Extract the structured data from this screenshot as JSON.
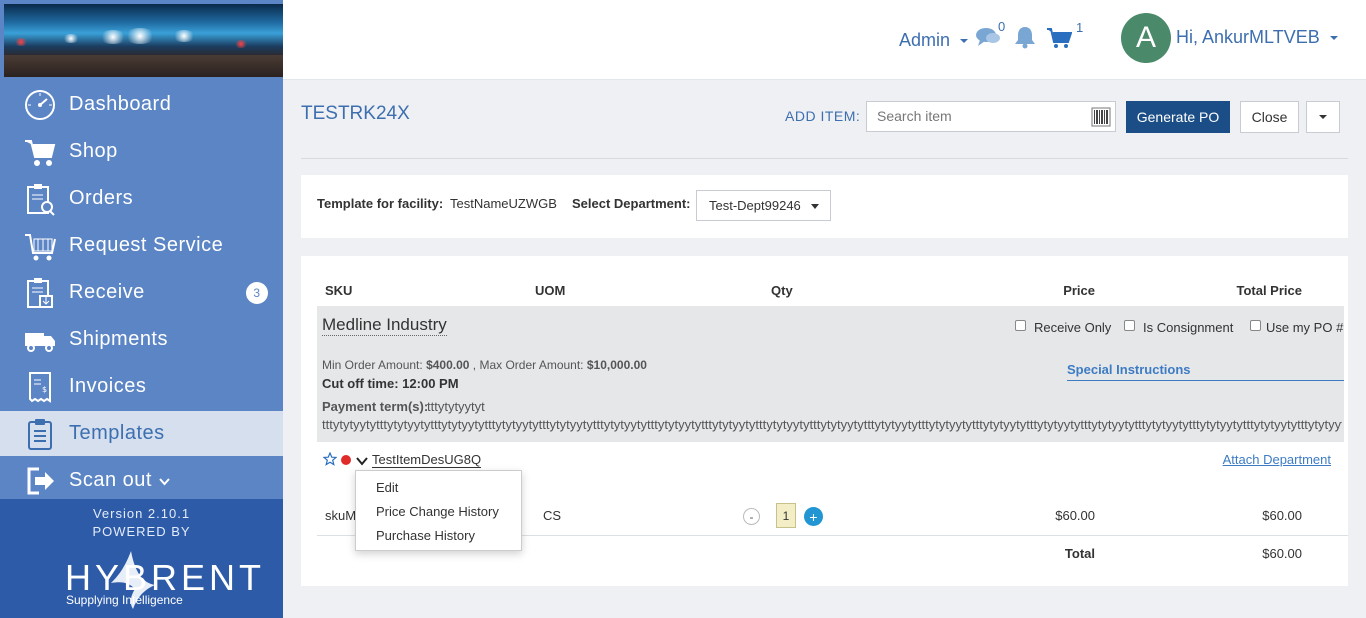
{
  "sidebar": {
    "items": [
      {
        "label": "Dashboard",
        "icon": "dashboard-icon"
      },
      {
        "label": "Shop",
        "icon": "cart-icon"
      },
      {
        "label": "Orders",
        "icon": "orders-icon"
      },
      {
        "label": "Request Service",
        "icon": "request-service-icon"
      },
      {
        "label": "Receive",
        "icon": "receive-icon",
        "badge": "3"
      },
      {
        "label": "Shipments",
        "icon": "truck-icon"
      },
      {
        "label": "Invoices",
        "icon": "invoice-icon"
      },
      {
        "label": "Templates",
        "icon": "templates-icon",
        "active": true
      },
      {
        "label": "Scan out",
        "icon": "scan-out-icon"
      }
    ],
    "version": "Version 2.10.1",
    "powered_by": "POWERED BY",
    "brand": "HYBRENT",
    "tagline": "Supplying Intelligence"
  },
  "header": {
    "admin_label": "Admin",
    "messages_count": "0",
    "cart_count": "1",
    "avatar_letter": "A",
    "greeting": "Hi, AnkurMLTVEB"
  },
  "toolbar": {
    "title": "TESTRK24X",
    "add_item_label": "ADD ITEM:",
    "search_placeholder": "Search item",
    "generate_po_label": "Generate PO",
    "close_label": "Close"
  },
  "facility": {
    "label": "Template for facility:",
    "value": "TestNameUZWGB",
    "dept_label": "Select Department:",
    "dept_value": "Test-Dept99246"
  },
  "table": {
    "headers": {
      "sku": "SKU",
      "uom": "UOM",
      "qty": "Qty",
      "price": "Price",
      "total_price": "Total Price"
    }
  },
  "vendor": {
    "name": "Medline Industry",
    "receive_only": "Receive Only",
    "is_consignment": "Is Consignment",
    "use_my_po": "Use my PO #",
    "min_order_label": "Min Order Amount:",
    "min_order_value": "$400.00",
    "max_order_label": "Max Order Amount:",
    "max_order_value": "$10,000.00",
    "cutoff_label": "Cut off time:",
    "cutoff_value": "12:00 PM",
    "special_instructions": "Special Instructions",
    "payment_label": "Payment term(s):",
    "payment_value": "tttytytyytyt",
    "payment_cont": "tttytytyytytttytytyytytttytytyytytttytytyytytttytytyytytttytytyytytttytytyytytttytytyytytttytytyytytttytytyytytttytytyytytttytytyytytttytytyytytttytytyytytttytytyytytttytytyytytttytytyytytttytytyytytttytytyytytttytytyytytttytytyytytttytytyytytttytytyyty"
  },
  "item": {
    "description": "TestItemDesUG8Q",
    "attach_department": "Attach Department",
    "sku": "skuM",
    "uom": "CS",
    "qty": "1",
    "qty_minus": "-",
    "qty_plus": "+",
    "price": "$60.00",
    "total_price": "$60.00"
  },
  "totals": {
    "label": "Total",
    "value": "$60.00"
  },
  "context_menu": {
    "items": [
      "Edit",
      "Price Change History",
      "Purchase History"
    ]
  }
}
